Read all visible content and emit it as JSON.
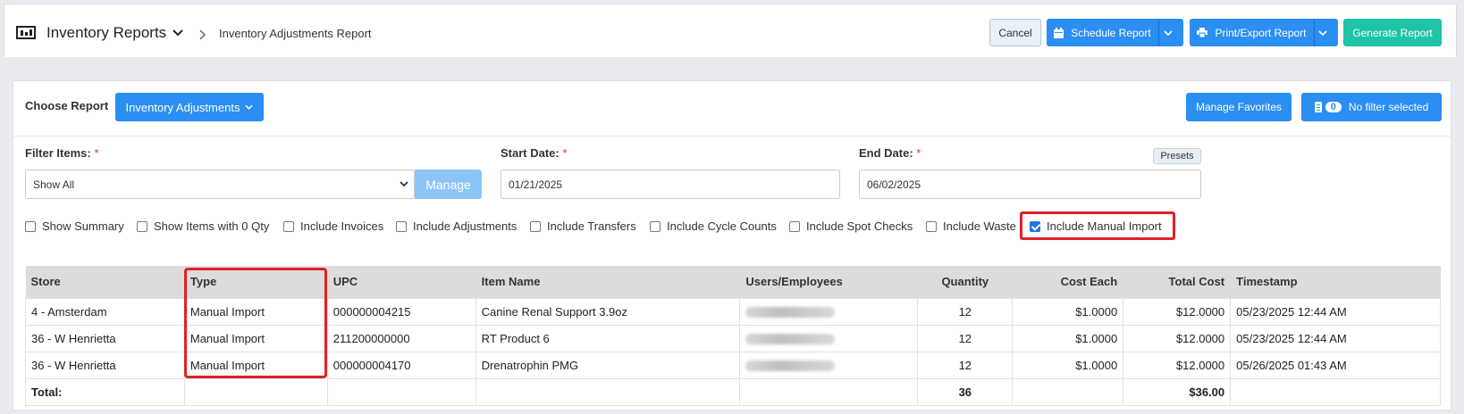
{
  "header": {
    "title": "Inventory Reports",
    "breadcrumb": "Inventory Adjustments Report",
    "cancel_label": "Cancel",
    "schedule_label": "Schedule Report",
    "print_label": "Print/Export Report",
    "generate_label": "Generate Report"
  },
  "report": {
    "choose_label": "Choose Report",
    "selected_report": "Inventory Adjustments",
    "manage_favorites_label": "Manage Favorites",
    "filter_count": "0",
    "filter_label": "No filter selected"
  },
  "filters": {
    "filter_items_label": "Filter Items:",
    "filter_items_value": "Show All",
    "manage_label": "Manage",
    "start_date_label": "Start Date:",
    "start_date_value": "01/21/2025",
    "end_date_label": "End Date:",
    "end_date_value": "06/02/2025",
    "presets_label": "Presets",
    "required_mark": "*"
  },
  "checkboxes": [
    {
      "label": "Show Summary",
      "checked": false
    },
    {
      "label": "Show Items with 0 Qty",
      "checked": false
    },
    {
      "label": "Include Invoices",
      "checked": false
    },
    {
      "label": "Include Adjustments",
      "checked": false
    },
    {
      "label": "Include Transfers",
      "checked": false
    },
    {
      "label": "Include Cycle Counts",
      "checked": false
    },
    {
      "label": "Include Spot Checks",
      "checked": false
    },
    {
      "label": "Include Waste",
      "checked": false
    },
    {
      "label": "Include Manual Import",
      "checked": true
    }
  ],
  "table": {
    "columns": [
      "Store",
      "Type",
      "UPC",
      "Item Name",
      "Users/Employees",
      "Quantity",
      "Cost Each",
      "Total Cost",
      "Timestamp"
    ],
    "rows": [
      {
        "store": "4 - Amsterdam",
        "type": "Manual Import",
        "upc": "000000004215",
        "item": "Canine Renal Support 3.9oz",
        "quantity": "12",
        "cost_each": "$1.0000",
        "total_cost": "$12.0000",
        "timestamp": "05/23/2025 12:44 AM"
      },
      {
        "store": "36 - W Henrietta",
        "type": "Manual Import",
        "upc": "211200000000",
        "item": "RT Product 6",
        "quantity": "12",
        "cost_each": "$1.0000",
        "total_cost": "$12.0000",
        "timestamp": "05/23/2025 12:44 AM"
      },
      {
        "store": "36 - W Henrietta",
        "type": "Manual Import",
        "upc": "000000004170",
        "item": "Drenatrophin PMG",
        "quantity": "12",
        "cost_each": "$1.0000",
        "total_cost": "$12.0000",
        "timestamp": "05/26/2025 01:43 AM"
      }
    ],
    "total_label": "Total:",
    "total_quantity": "36",
    "total_cost": "$36.00"
  },
  "colors": {
    "primary": "#2b8ef2",
    "success": "#1ec4a5",
    "highlight": "#e0202a"
  }
}
